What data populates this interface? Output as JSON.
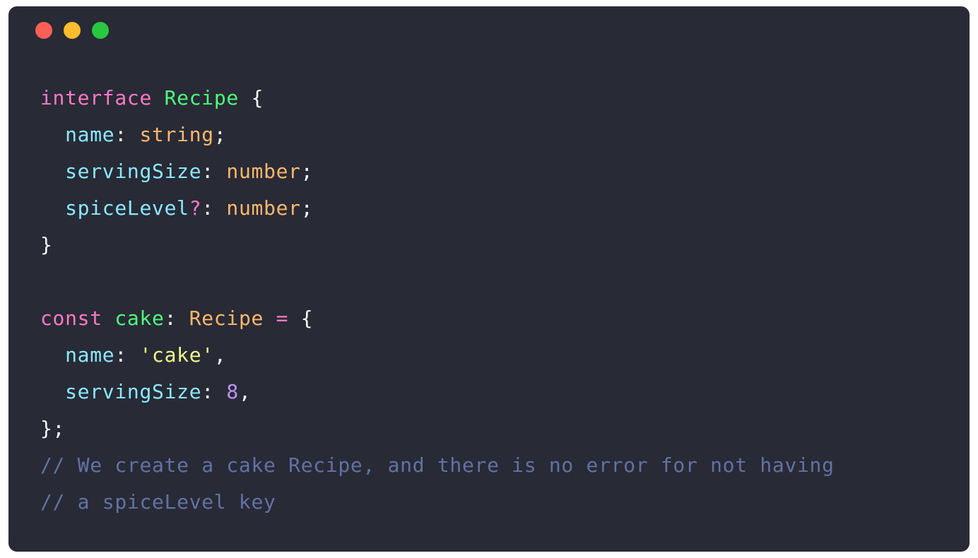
{
  "window": {
    "controls": [
      {
        "name": "close-dot",
        "color": "#ff5f57"
      },
      {
        "name": "minimize-dot",
        "color": "#febc2e"
      },
      {
        "name": "maximize-dot",
        "color": "#28c840"
      }
    ]
  },
  "code": {
    "lines": [
      [
        {
          "t": "interface",
          "k": "keyword"
        },
        {
          "t": " ",
          "k": "plain"
        },
        {
          "t": "Recipe",
          "k": "type-name"
        },
        {
          "t": " {",
          "k": "plain"
        }
      ],
      [
        {
          "t": "  ",
          "k": "plain"
        },
        {
          "t": "name",
          "k": "prop"
        },
        {
          "t": ": ",
          "k": "plain"
        },
        {
          "t": "string",
          "k": "type"
        },
        {
          "t": ";",
          "k": "plain"
        }
      ],
      [
        {
          "t": "  ",
          "k": "plain"
        },
        {
          "t": "servingSize",
          "k": "prop"
        },
        {
          "t": ": ",
          "k": "plain"
        },
        {
          "t": "number",
          "k": "type"
        },
        {
          "t": ";",
          "k": "plain"
        }
      ],
      [
        {
          "t": "  ",
          "k": "plain"
        },
        {
          "t": "spiceLevel",
          "k": "prop"
        },
        {
          "t": "?",
          "k": "keyword"
        },
        {
          "t": ": ",
          "k": "plain"
        },
        {
          "t": "number",
          "k": "type"
        },
        {
          "t": ";",
          "k": "plain"
        }
      ],
      [
        {
          "t": "}",
          "k": "plain"
        }
      ],
      [],
      [
        {
          "t": "const",
          "k": "keyword"
        },
        {
          "t": " ",
          "k": "plain"
        },
        {
          "t": "cake",
          "k": "type-name"
        },
        {
          "t": ": ",
          "k": "plain"
        },
        {
          "t": "Recipe",
          "k": "type"
        },
        {
          "t": " ",
          "k": "plain"
        },
        {
          "t": "=",
          "k": "keyword"
        },
        {
          "t": " {",
          "k": "plain"
        }
      ],
      [
        {
          "t": "  ",
          "k": "plain"
        },
        {
          "t": "name",
          "k": "prop"
        },
        {
          "t": ": ",
          "k": "plain"
        },
        {
          "t": "'cake'",
          "k": "string"
        },
        {
          "t": ",",
          "k": "plain"
        }
      ],
      [
        {
          "t": "  ",
          "k": "plain"
        },
        {
          "t": "servingSize",
          "k": "prop"
        },
        {
          "t": ": ",
          "k": "plain"
        },
        {
          "t": "8",
          "k": "number"
        },
        {
          "t": ",",
          "k": "plain"
        }
      ],
      [
        {
          "t": "};",
          "k": "plain"
        }
      ],
      [
        {
          "t": "// We create a cake Recipe, and there is no error for not having",
          "k": "comment"
        }
      ],
      [
        {
          "t": "// a spiceLevel key",
          "k": "comment"
        }
      ]
    ]
  }
}
